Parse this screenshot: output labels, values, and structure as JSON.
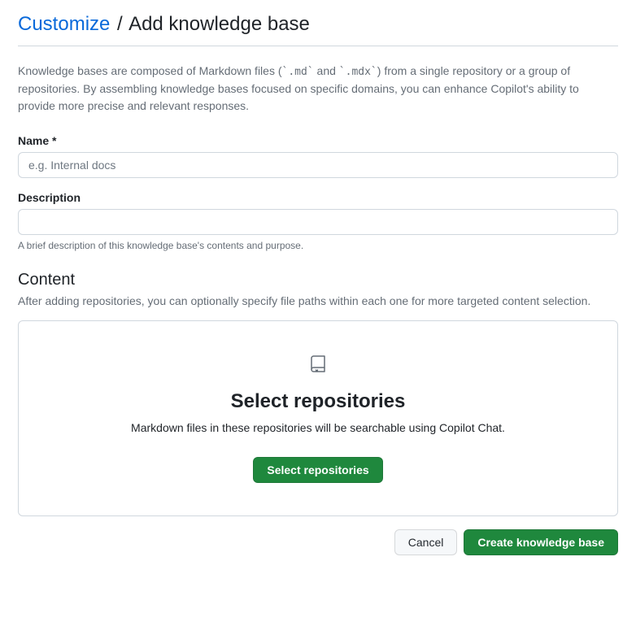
{
  "breadcrumb": {
    "parent": "Customize",
    "separator": "/",
    "current": "Add knowledge base"
  },
  "intro": {
    "prefix": "Knowledge bases are composed of Markdown files (",
    "code1": "`.md`",
    "and": " and ",
    "code2": "`.mdx`",
    "suffix": ") from a single repository or a group of repositories. By assembling knowledge bases focused on specific domains, you can enhance Copilot's ability to provide more precise and relevant responses."
  },
  "form": {
    "name": {
      "label": "Name *",
      "placeholder": "e.g. Internal docs",
      "value": ""
    },
    "description": {
      "label": "Description",
      "value": "",
      "hint": "A brief description of this knowledge base's contents and purpose."
    }
  },
  "content": {
    "heading": "Content",
    "sub": "After adding repositories, you can optionally specify file paths within each one for more targeted content selection.",
    "blankslate": {
      "title": "Select repositories",
      "text": "Markdown files in these repositories will be searchable using Copilot Chat.",
      "button": "Select repositories"
    }
  },
  "actions": {
    "cancel": "Cancel",
    "submit": "Create knowledge base"
  }
}
